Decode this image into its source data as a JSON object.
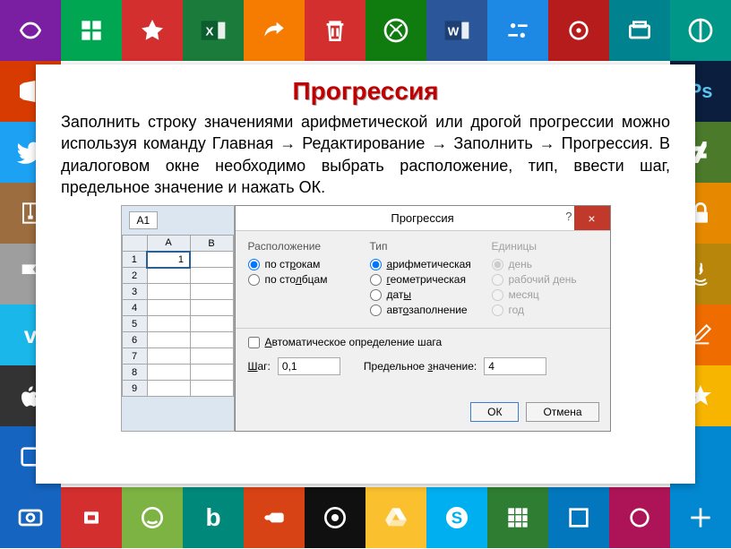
{
  "title": "Прогрессия",
  "body_text": "Заполнить строку значениями арифметической или дрогой прогрессии можно используя команду Главная → Редактирование → Заполнить → Прогрессия. В диалоговом окне необходимо выбрать расположение, тип, ввести шаг, предельное значение и нажать ОК.",
  "excel": {
    "namebox": "A1",
    "cols": [
      "A",
      "B"
    ],
    "rows": [
      "1",
      "2",
      "3",
      "4",
      "5",
      "6",
      "7",
      "8",
      "9"
    ],
    "cell_a1": "1"
  },
  "dialog": {
    "title": "Прогрессия",
    "help": "?",
    "close": "×",
    "group_location": {
      "label": "Расположение",
      "rows": "по строкам",
      "cols": "по столбцам"
    },
    "group_type": {
      "label": "Тип",
      "arith": "арифметическая",
      "geom": "геометрическая",
      "dates": "даты",
      "auto": "автозаполнение"
    },
    "group_units": {
      "label": "Единицы",
      "day": "день",
      "workday": "рабочий день",
      "month": "месяц",
      "year": "год"
    },
    "auto_step": "Автоматическое определение шага",
    "step_label": "Шаг:",
    "step_value": "0,1",
    "limit_label": "Предельное значение:",
    "limit_value": "4",
    "ok": "ОК",
    "cancel": "Отмена"
  },
  "tiles": [
    {
      "bg": "#7b1fa2"
    },
    {
      "bg": "#00a651"
    },
    {
      "bg": "#d32f2f"
    },
    {
      "bg": "#1b7b3a"
    },
    {
      "bg": "#f57c00"
    },
    {
      "bg": "#d32f2f"
    },
    {
      "bg": "#107c10"
    },
    {
      "bg": "#2b579a"
    },
    {
      "bg": "#1e88e5"
    },
    {
      "bg": "#b71c1c"
    },
    {
      "bg": "#00838f"
    },
    {
      "bg": "#009688"
    },
    {
      "bg": "#d83b01"
    },
    {
      "bg": "#0b1e3d"
    },
    {
      "bg": "#1da1f2"
    },
    {
      "bg": "#4a7a2a"
    },
    {
      "bg": "#9c6d3e"
    },
    {
      "bg": "#e68900"
    },
    {
      "bg": "#9e9e9e"
    },
    {
      "bg": "#b8860b"
    },
    {
      "bg": "#1ab7ea"
    },
    {
      "bg": "#ef6c00"
    },
    {
      "bg": "#333333"
    },
    {
      "bg": "#f7b500"
    },
    {
      "bg": "#1565c0"
    },
    {
      "bg": "#d32f2f"
    },
    {
      "bg": "#7cb342"
    },
    {
      "bg": "#00897b"
    },
    {
      "bg": "#d84315"
    },
    {
      "bg": "#101010"
    },
    {
      "bg": "#fbc02d"
    },
    {
      "bg": "#00aff0"
    },
    {
      "bg": "#2e7d32"
    },
    {
      "bg": "#0277bd"
    },
    {
      "bg": "#ad1457"
    },
    {
      "bg": "#0288d1"
    }
  ]
}
